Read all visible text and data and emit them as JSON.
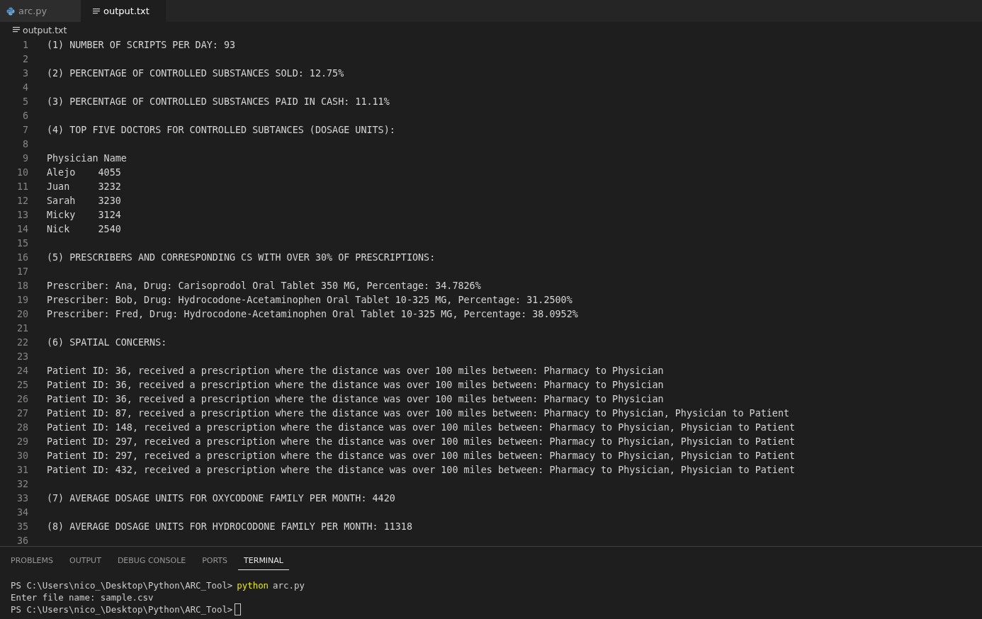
{
  "tabs": [
    {
      "label": "arc.py",
      "kind": "python",
      "selected": false
    },
    {
      "label": "output.txt",
      "kind": "text",
      "selected": true
    }
  ],
  "breadcrumb": {
    "label": "output.txt"
  },
  "editor": {
    "lines": [
      {
        "number": "1",
        "text": "(1) NUMBER OF SCRIPTS PER DAY: 93"
      },
      {
        "number": "2"
      },
      {
        "number": "3",
        "text": "(2) PERCENTAGE OF CONTROLLED SUBSTANCES SOLD: 12.75%"
      },
      {
        "number": "4"
      },
      {
        "number": "5",
        "text": "(3) PERCENTAGE OF CONTROLLED SUBSTANCES PAID IN CASH: 11.11%"
      },
      {
        "number": "6"
      },
      {
        "number": "7",
        "text": "(4) TOP FIVE DOCTORS FOR CONTROLLED SUBTANCES (DOSAGE UNITS):"
      },
      {
        "number": "8"
      },
      {
        "number": "9",
        "text": "Physician Name"
      },
      {
        "number": "10",
        "text": "Alejo    4055"
      },
      {
        "number": "11",
        "text": "Juan     3232"
      },
      {
        "number": "12",
        "text": "Sarah    3230"
      },
      {
        "number": "13",
        "text": "Micky    3124"
      },
      {
        "number": "14",
        "text": "Nick     2540"
      },
      {
        "number": "15"
      },
      {
        "number": "16",
        "text": "(5) PRESCRIBERS AND CORRESPONDING CS WITH OVER 30% OF PRESCRIPTIONS:"
      },
      {
        "number": "17"
      },
      {
        "number": "18",
        "text": "Prescriber: Ana, Drug: Carisoprodol Oral Tablet 350 MG, Percentage: 34.7826%"
      },
      {
        "number": "19",
        "text": "Prescriber: Bob, Drug: Hydrocodone-Acetaminophen Oral Tablet 10-325 MG, Percentage: 31.2500%"
      },
      {
        "number": "20",
        "text": "Prescriber: Fred, Drug: Hydrocodone-Acetaminophen Oral Tablet 10-325 MG, Percentage: 38.0952%"
      },
      {
        "number": "21"
      },
      {
        "number": "22",
        "text": "(6) SPATIAL CONCERNS:"
      },
      {
        "number": "23"
      },
      {
        "number": "24",
        "text": "Patient ID: 36, received a prescription where the distance was over 100 miles between: Pharmacy to Physician"
      },
      {
        "number": "25",
        "text": "Patient ID: 36, received a prescription where the distance was over 100 miles between: Pharmacy to Physician"
      },
      {
        "number": "26",
        "text": "Patient ID: 36, received a prescription where the distance was over 100 miles between: Pharmacy to Physician"
      },
      {
        "number": "27",
        "text": "Patient ID: 87, received a prescription where the distance was over 100 miles between: Pharmacy to Physician, Physician to Patient"
      },
      {
        "number": "28",
        "text": "Patient ID: 148, received a prescription where the distance was over 100 miles between: Pharmacy to Physician, Physician to Patient"
      },
      {
        "number": "29",
        "text": "Patient ID: 297, received a prescription where the distance was over 100 miles between: Pharmacy to Physician, Physician to Patient"
      },
      {
        "number": "30",
        "text": "Patient ID: 297, received a prescription where the distance was over 100 miles between: Pharmacy to Physician, Physician to Patient"
      },
      {
        "number": "31",
        "text": "Patient ID: 432, received a prescription where the distance was over 100 miles between: Pharmacy to Physician, Physician to Patient"
      },
      {
        "number": "32"
      },
      {
        "number": "33",
        "text": "(7) AVERAGE DOSAGE UNITS FOR OXYCODONE FAMILY PER MONTH: 4420"
      },
      {
        "number": "34"
      },
      {
        "number": "35",
        "text": "(8) AVERAGE DOSAGE UNITS FOR HYDROCODONE FAMILY PER MONTH: 11318"
      },
      {
        "number": "36"
      }
    ]
  },
  "panel": {
    "tabs": [
      {
        "label": "PROBLEMS",
        "selected": false
      },
      {
        "label": "OUTPUT",
        "selected": false
      },
      {
        "label": "DEBUG CONSOLE",
        "selected": false
      },
      {
        "label": "PORTS",
        "selected": false
      },
      {
        "label": "TERMINAL",
        "selected": true
      }
    ],
    "terminal": [
      {
        "parts": [
          {
            "kind": "prompt",
            "text": "PS C:\\Users\\nico_\\Desktop\\Python\\ARC_Tool>"
          },
          {
            "kind": "command",
            "text": "python"
          },
          {
            "kind": "plain",
            "text": "arc.py"
          }
        ],
        "cursor": false
      },
      {
        "parts": [
          {
            "kind": "plain",
            "text": "Enter file name: sample.csv"
          }
        ],
        "cursor": false
      },
      {
        "parts": [
          {
            "kind": "prompt",
            "text": "PS C:\\Users\\nico_\\Desktop\\Python\\ARC_Tool>"
          }
        ],
        "cursor": true
      }
    ]
  }
}
